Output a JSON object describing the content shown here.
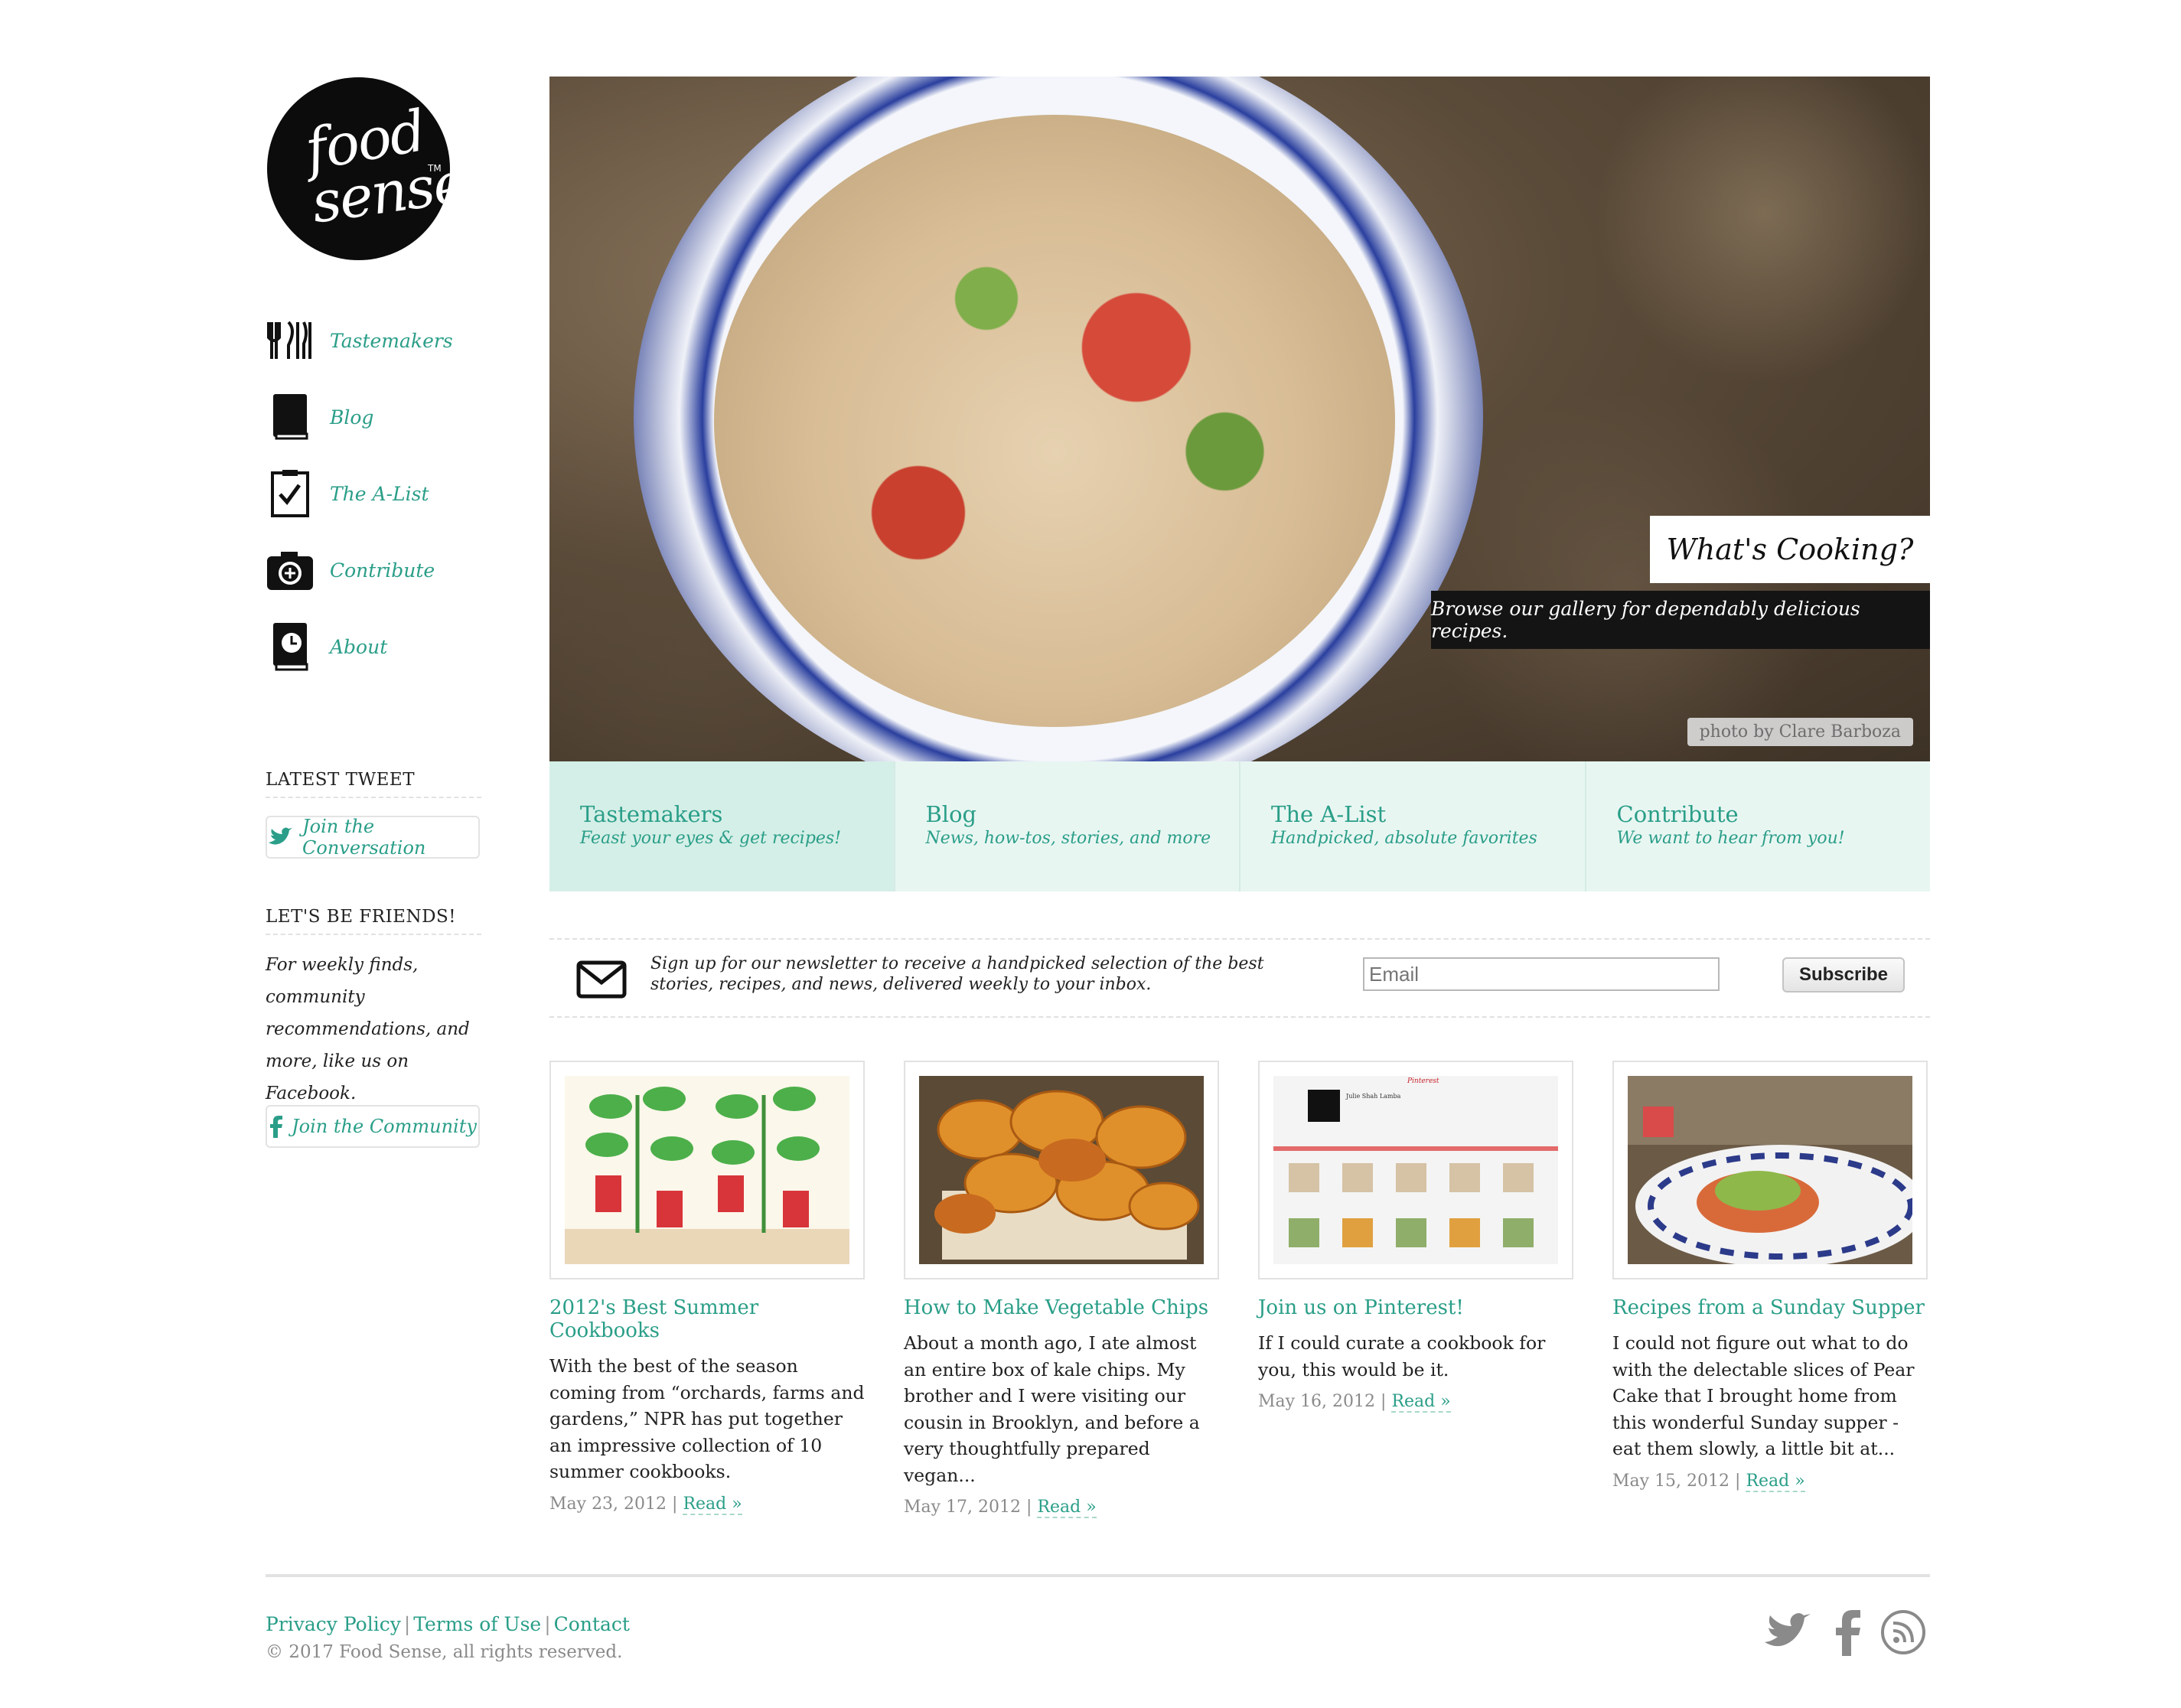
{
  "brand": {
    "logo_line1": "food",
    "logo_line2": "sense",
    "tm": "TM"
  },
  "sidebar": {
    "nav": [
      {
        "label": "Tastemakers",
        "icon": "utensils-icon"
      },
      {
        "label": "Blog",
        "icon": "book-icon"
      },
      {
        "label": "The A-List",
        "icon": "clipboard-check-icon"
      },
      {
        "label": "Contribute",
        "icon": "camera-icon"
      },
      {
        "label": "About",
        "icon": "cookbook-icon"
      }
    ],
    "latest_tweet_heading": "LATEST TWEET",
    "tweet_button": "Join the Conversation",
    "friends_heading": "LET'S BE FRIENDS!",
    "friends_text": "For weekly finds, community recommendations, and more, like us on Facebook.",
    "community_button": "Join the Community"
  },
  "hero": {
    "title": "What's Cooking?",
    "subtitle": "Browse our gallery for dependably delicious recipes.",
    "credit": "photo by Clare Barboza"
  },
  "tabs": [
    {
      "title": "Tastemakers",
      "sub": "Feast your eyes & get recipes!"
    },
    {
      "title": "Blog",
      "sub": "News, how-tos, stories, and more"
    },
    {
      "title": "The A-List",
      "sub": "Handpicked, absolute favorites"
    },
    {
      "title": "Contribute",
      "sub": "We want to hear from you!"
    }
  ],
  "newsletter": {
    "text": "Sign up for our newsletter to receive a handpicked selection of the best stories, recipes, and news, delivered weekly to your inbox.",
    "email_placeholder": "Email",
    "button": "Subscribe"
  },
  "articles": [
    {
      "title": "2012's Best Summer Cookbooks",
      "excerpt": "With the best of the season coming from “orchards, farms and gardens,” NPR has put together an impressive collection of 10 summer cookbooks.",
      "date": "May 23, 2012",
      "read": "Read »"
    },
    {
      "title": "How to Make Vegetable Chips",
      "excerpt": "About a month ago, I ate almost an entire box of kale chips. My brother and I were visiting our cousin in Brooklyn, and before a very thoughtfully prepared vegan...",
      "date": "May 17, 2012",
      "read": "Read »"
    },
    {
      "title": "Join us on Pinterest!",
      "excerpt": "If I could curate a cookbook for you, this would be it.",
      "date": "May 16, 2012",
      "read": "Read »"
    },
    {
      "title": "Recipes from a Sunday Supper",
      "excerpt": "I could not figure out what to do with the delectable slices of Pear Cake that I brought home from this wonderful Sunday supper - eat them slowly, a little bit at...",
      "date": "May 15, 2012",
      "read": "Read »"
    }
  ],
  "pinterest_thumb": {
    "logo": "Pinterest",
    "name": "Julie Shah Lamba"
  },
  "footer": {
    "links": [
      "Privacy Policy",
      "Terms of Use",
      "Contact"
    ],
    "separator": "|",
    "copyright": "© 2017 Food Sense, all rights reserved.",
    "social": [
      "twitter-icon",
      "facebook-icon",
      "rss-icon"
    ]
  },
  "colors": {
    "accent": "#2a9e88",
    "tab_bg": "#e8f6f2",
    "tab_active": "#d4efe7"
  }
}
